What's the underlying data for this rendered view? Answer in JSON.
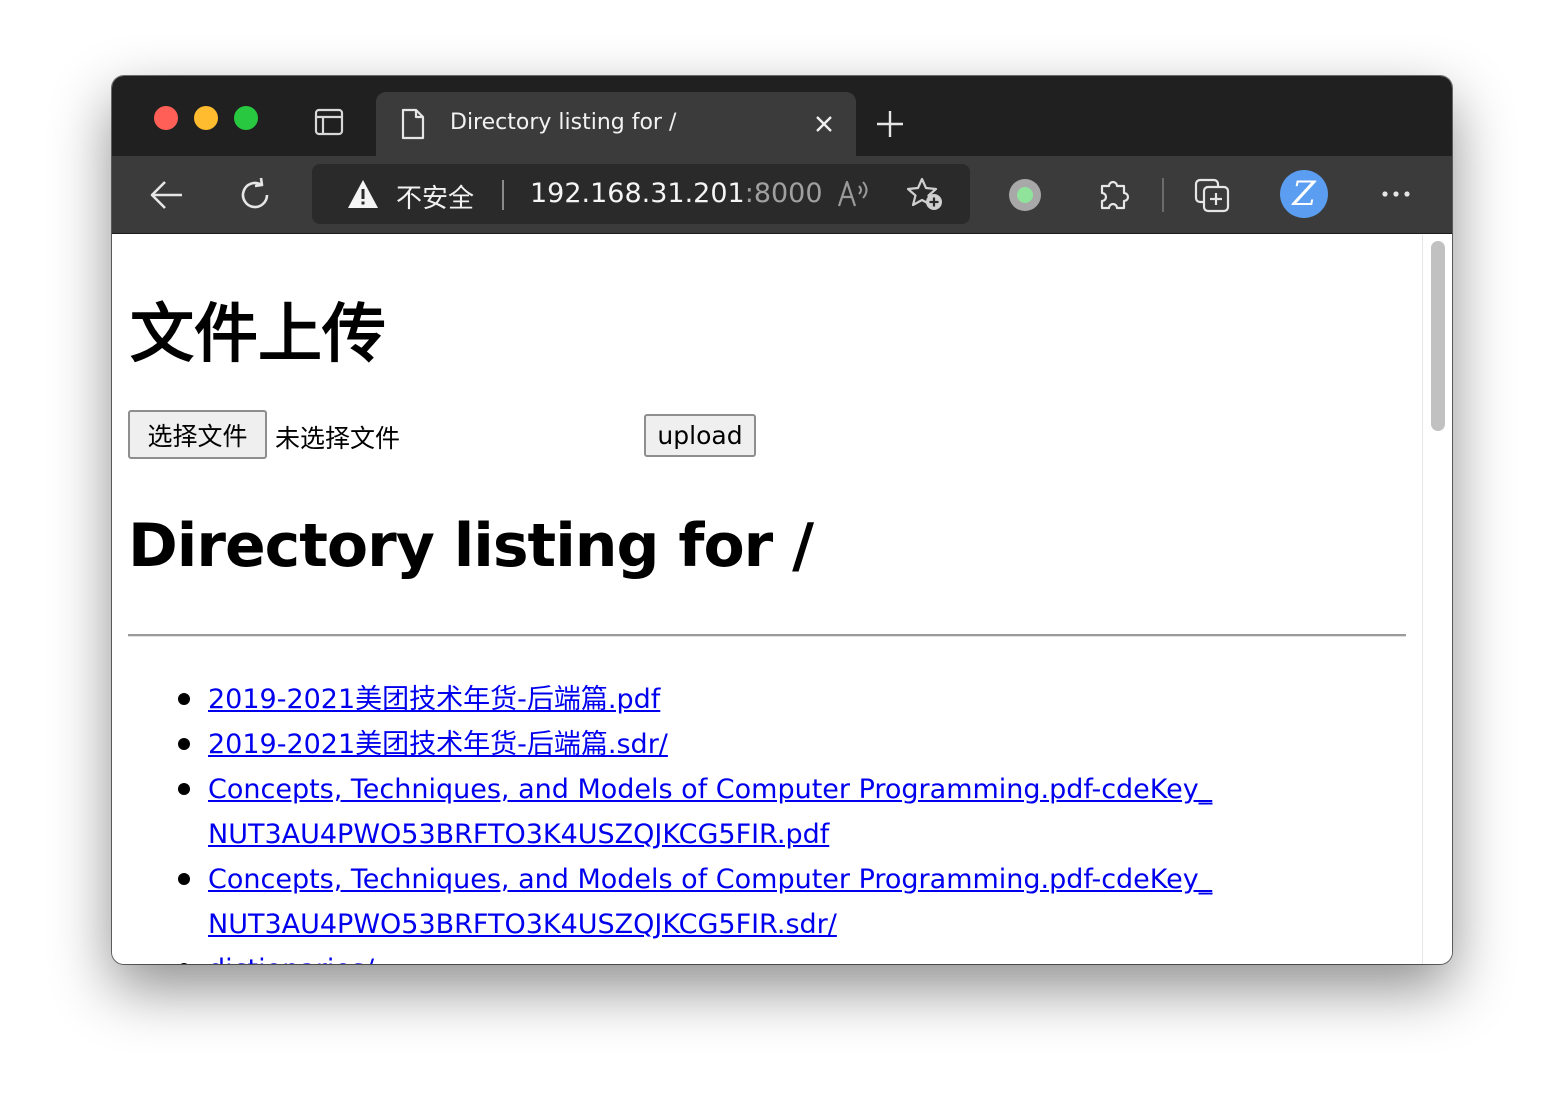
{
  "tab": {
    "title": "Directory listing for /",
    "close_label": "×",
    "new_tab_label": "+"
  },
  "toolbar": {
    "security_label": "不安全",
    "url_host": "192.168.31.201",
    "url_port": ":8000",
    "profile_initial": "Z",
    "more_label": "···"
  },
  "page": {
    "upload_heading": "文件上传",
    "choose_file_label": "选择文件",
    "no_file_text": "未选择文件",
    "upload_button_label": "upload",
    "listing_heading": "Directory listing for /",
    "files": [
      "2019-2021美团技术年货-后端篇.pdf",
      "2019-2021美团技术年货-后端篇.sdr/",
      "Concepts, Techniques, and Models of Computer Programming.pdf-cdeKey_NUT3AU4PWO53BRFTO3K4USZQJKCG5FIR.pdf",
      "Concepts, Techniques, and Models of Computer Programming.pdf-cdeKey_NUT3AU4PWO53BRFTO3K4USZQJKCG5FIR.sdr/",
      "dictionaries/"
    ]
  },
  "colors": {
    "link": "#0000ee",
    "tabstrip_bg": "#202020",
    "toolbar_bg": "#3b3b3b",
    "profile_bg": "#5b9df0"
  }
}
